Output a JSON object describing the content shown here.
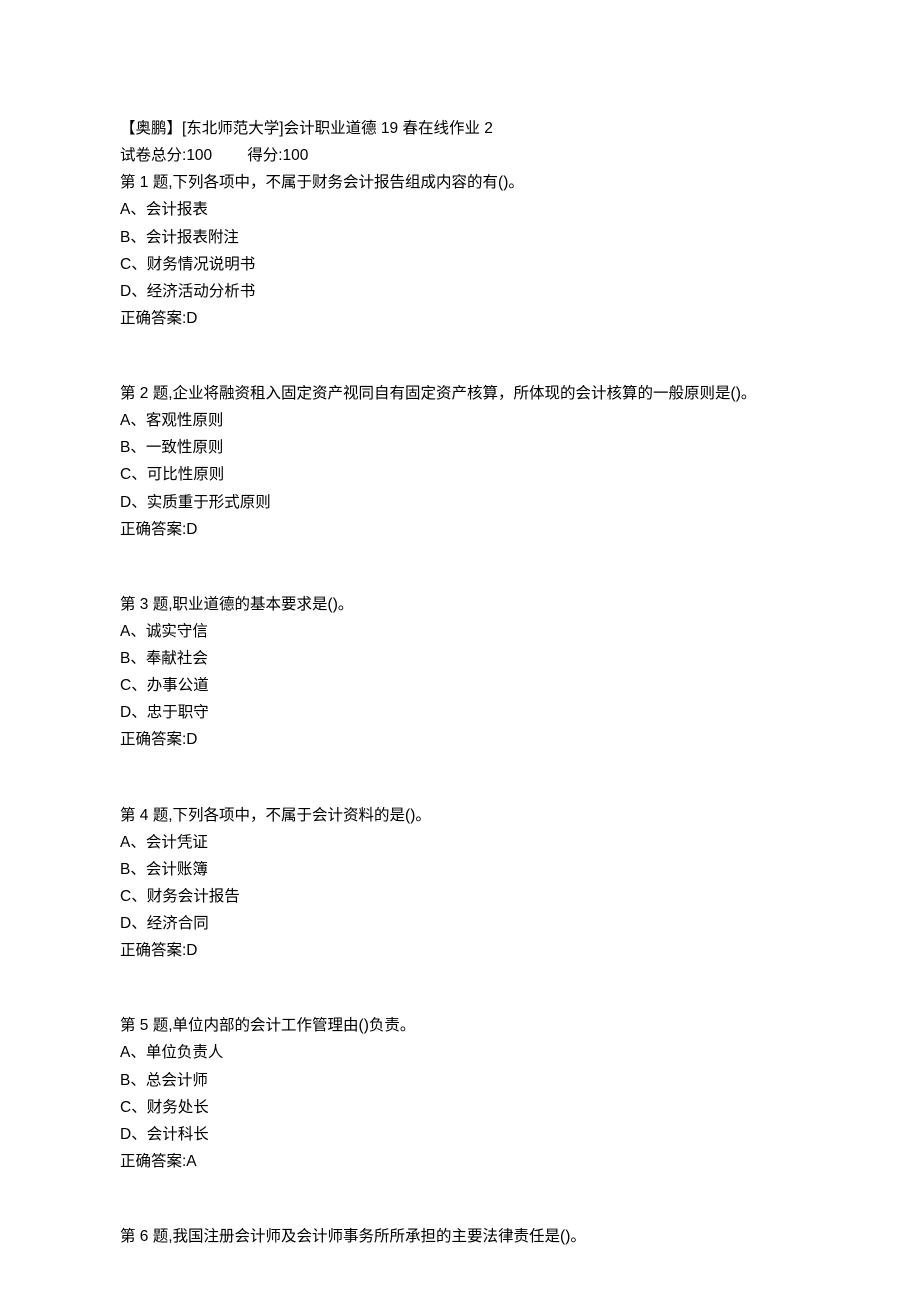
{
  "header": {
    "title": "【奥鹏】[东北师范大学]会计职业道德 19 春在线作业 2",
    "total_label": "试卷总分:",
    "total": "100",
    "score_label": "得分:",
    "score": "100"
  },
  "questions": [
    {
      "stem": "第 1 题,下列各项中，不属于财务会计报告组成内容的有()。",
      "opts": [
        "A、会计报表",
        "B、会计报表附注",
        "C、财务情况说明书",
        "D、经济活动分析书"
      ],
      "ans": "正确答案:D"
    },
    {
      "stem": "第 2 题,企业将融资租入固定资产视同自有固定资产核算，所体现的会计核算的一般原则是()。",
      "opts": [
        "A、客观性原则",
        "B、一致性原则",
        "C、可比性原则",
        "D、实质重于形式原则"
      ],
      "ans": "正确答案:D"
    },
    {
      "stem": "第 3 题,职业道德的基本要求是()。",
      "opts": [
        "A、诚实守信",
        "B、奉献社会",
        "C、办事公道",
        "D、忠于职守"
      ],
      "ans": "正确答案:D"
    },
    {
      "stem": "第 4 题,下列各项中，不属于会计资料的是()。",
      "opts": [
        "A、会计凭证",
        "B、会计账簿",
        "C、财务会计报告",
        "D、经济合同"
      ],
      "ans": "正确答案:D"
    },
    {
      "stem": "第 5 题,单位内部的会计工作管理由()负责。",
      "opts": [
        "A、单位负责人",
        "B、总会计师",
        "C、财务处长",
        "D、会计科长"
      ],
      "ans": "正确答案:A"
    },
    {
      "stem": "第 6 题,我国注册会计师及会计师事务所所承担的主要法律责任是()。",
      "opts": [],
      "ans": ""
    }
  ]
}
